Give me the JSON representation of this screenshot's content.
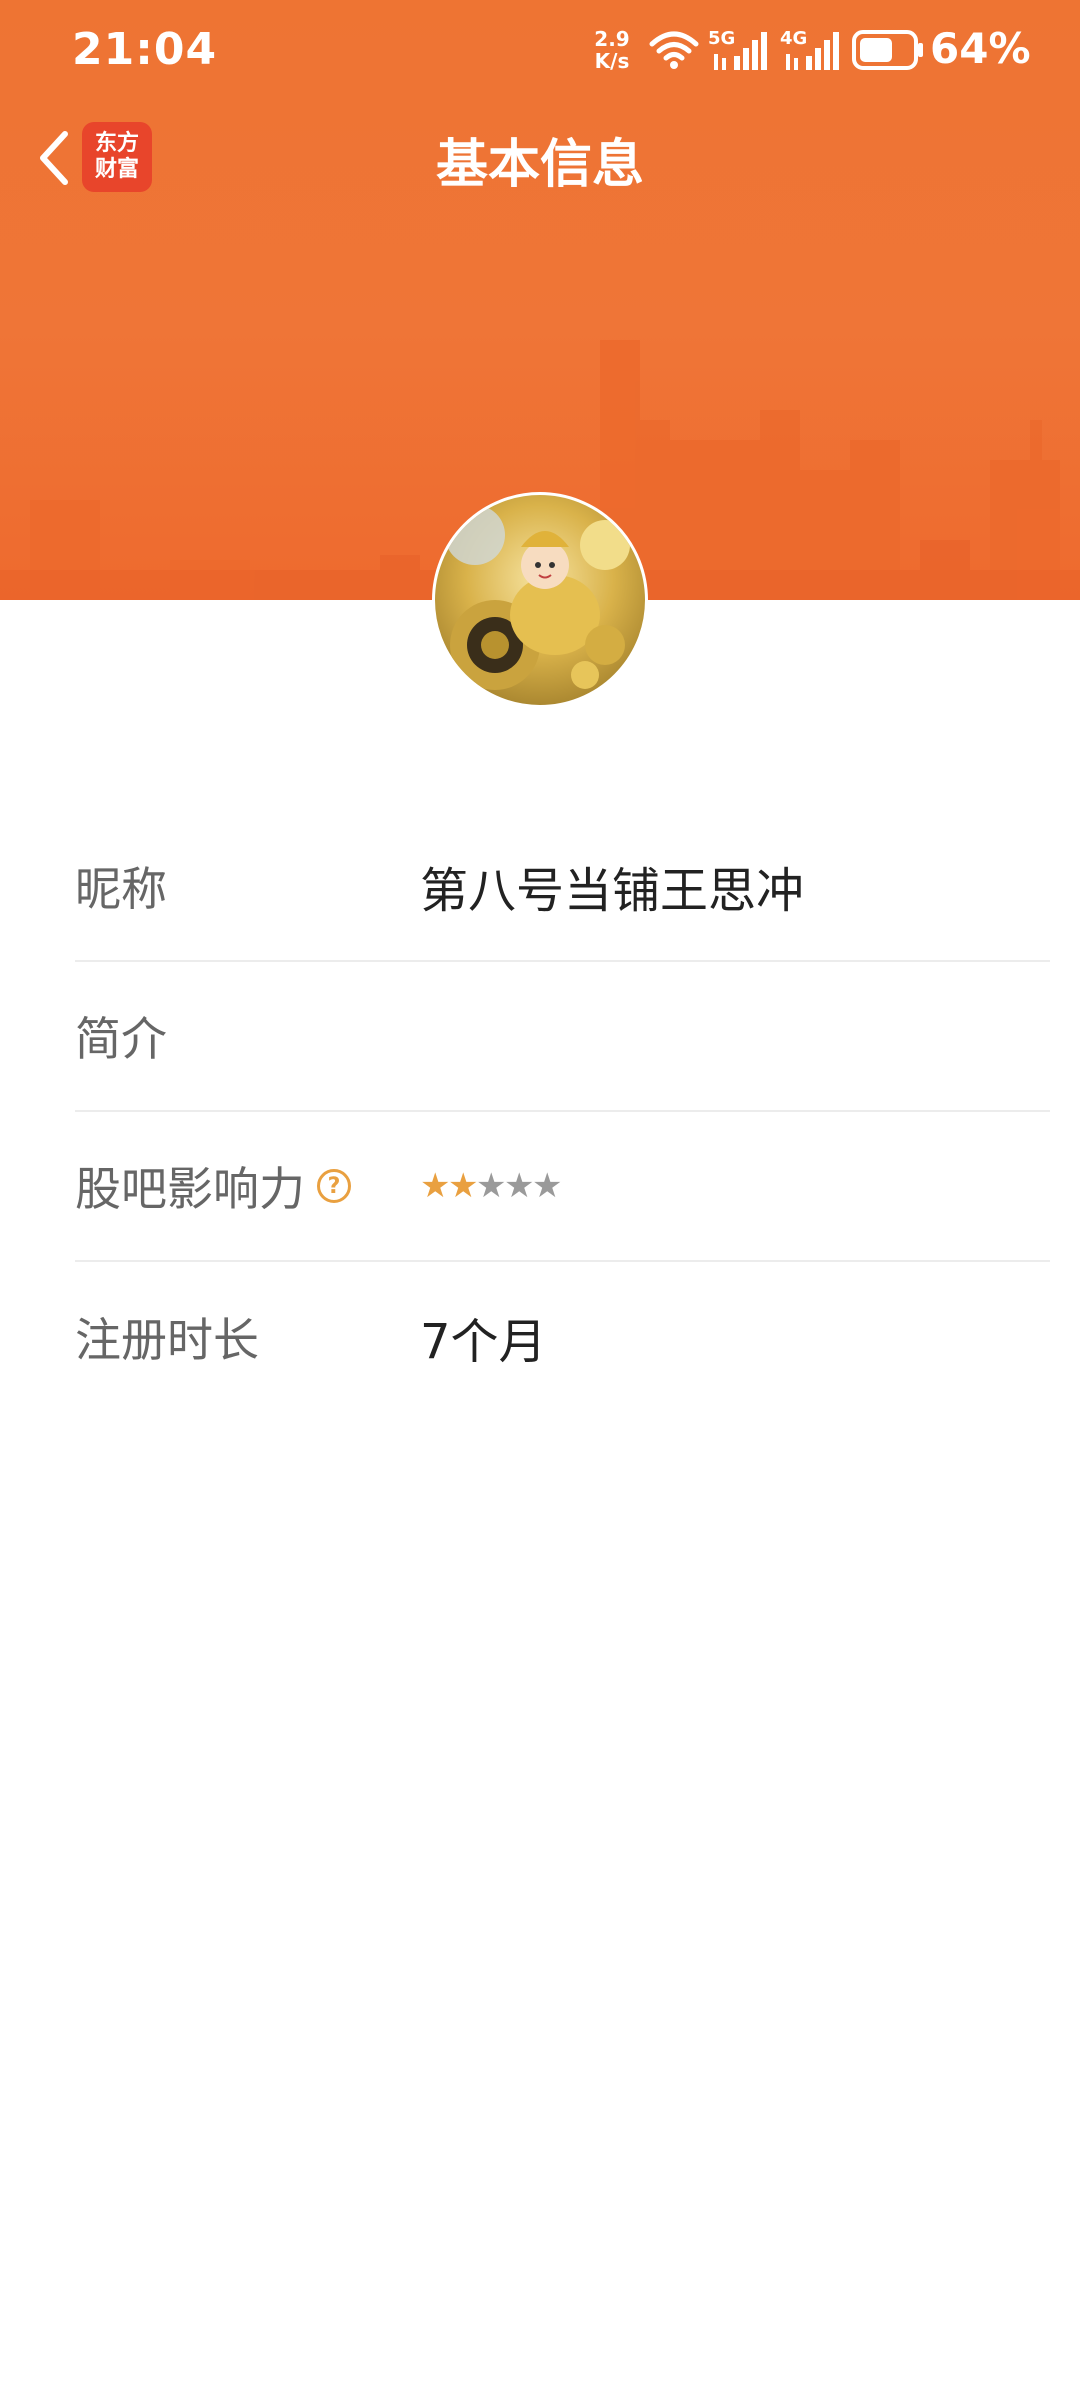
{
  "status_bar": {
    "time": "21:04",
    "net_speed_value": "2.9",
    "net_speed_unit": "K/s",
    "sim1_label": "5G",
    "sim2_label": "4G",
    "battery_percent": "64%",
    "battery_level": 0.64
  },
  "nav": {
    "app_logo_line1": "东方",
    "app_logo_line2": "财富",
    "title": "基本信息"
  },
  "profile": {
    "rows": [
      {
        "label": "昵称",
        "value": "第八号当铺王思冲"
      },
      {
        "label": "简介",
        "value": ""
      },
      {
        "label": "股吧影响力",
        "help_icon": "?",
        "rating": 2,
        "rating_max": 5
      },
      {
        "label": "注册时长",
        "value": "7个月"
      }
    ]
  },
  "colors": {
    "brand_orange": "#ee7433",
    "star_active": "#e9a040",
    "star_inactive": "#9a9a9a",
    "logo_red": "#e8452b"
  }
}
